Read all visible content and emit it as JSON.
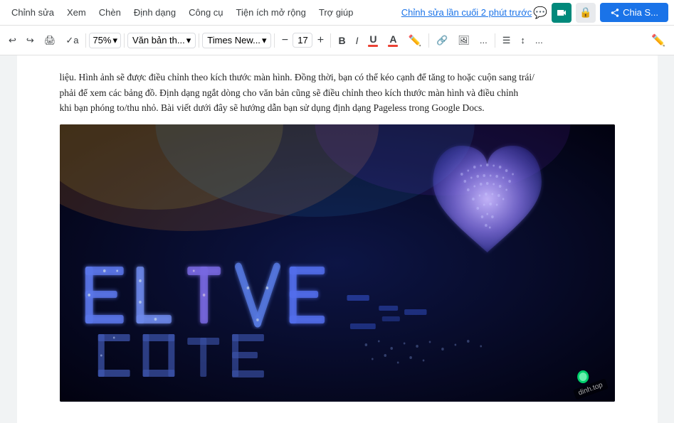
{
  "menu": {
    "items": [
      {
        "label": "Chỉnh sửa",
        "key": "edit"
      },
      {
        "label": "Xem",
        "key": "view"
      },
      {
        "label": "Chèn",
        "key": "insert"
      },
      {
        "label": "Định dạng",
        "key": "format"
      },
      {
        "label": "Công cụ",
        "key": "tools"
      },
      {
        "label": "Tiện ích mở rộng",
        "key": "extensions"
      },
      {
        "label": "Trợ giúp",
        "key": "help"
      }
    ],
    "last_edit": "Chỉnh sửa lần cuối 2 phút trước"
  },
  "toolbar": {
    "zoom": "75%",
    "style": "Văn bản th...",
    "font": "Times New...",
    "font_size": "17",
    "bold": "B",
    "italic": "I",
    "underline": "U",
    "more": "..."
  },
  "doc": {
    "text1": "liệu. Hình ảnh sẽ được điều chỉnh theo kích thước màn hình. Đồng thời, bạn có thể kéo cạnh để tăng to hoặc cuộn sang trái/",
    "text2": "phải để xem các bảng đồ. Định dạng ngắt dòng cho văn bản cũng sẽ điều chỉnh theo kích thước màn hình và điều chỉnh",
    "text3": "khi bạn phóng to/thu nhỏ. Bài viết dưới đây sẽ hướng dẫn bạn sử dụng định dạng Pageless trong Google Docs."
  },
  "header": {
    "share_label": "Chia S...",
    "chat_icon": "💬",
    "meet_icon": "📹",
    "lock_icon": "🔒"
  },
  "image": {
    "alt": "Concert drone light show with heart shape and text formed by drones",
    "watermark": "dinh.top",
    "green_dot": true
  }
}
